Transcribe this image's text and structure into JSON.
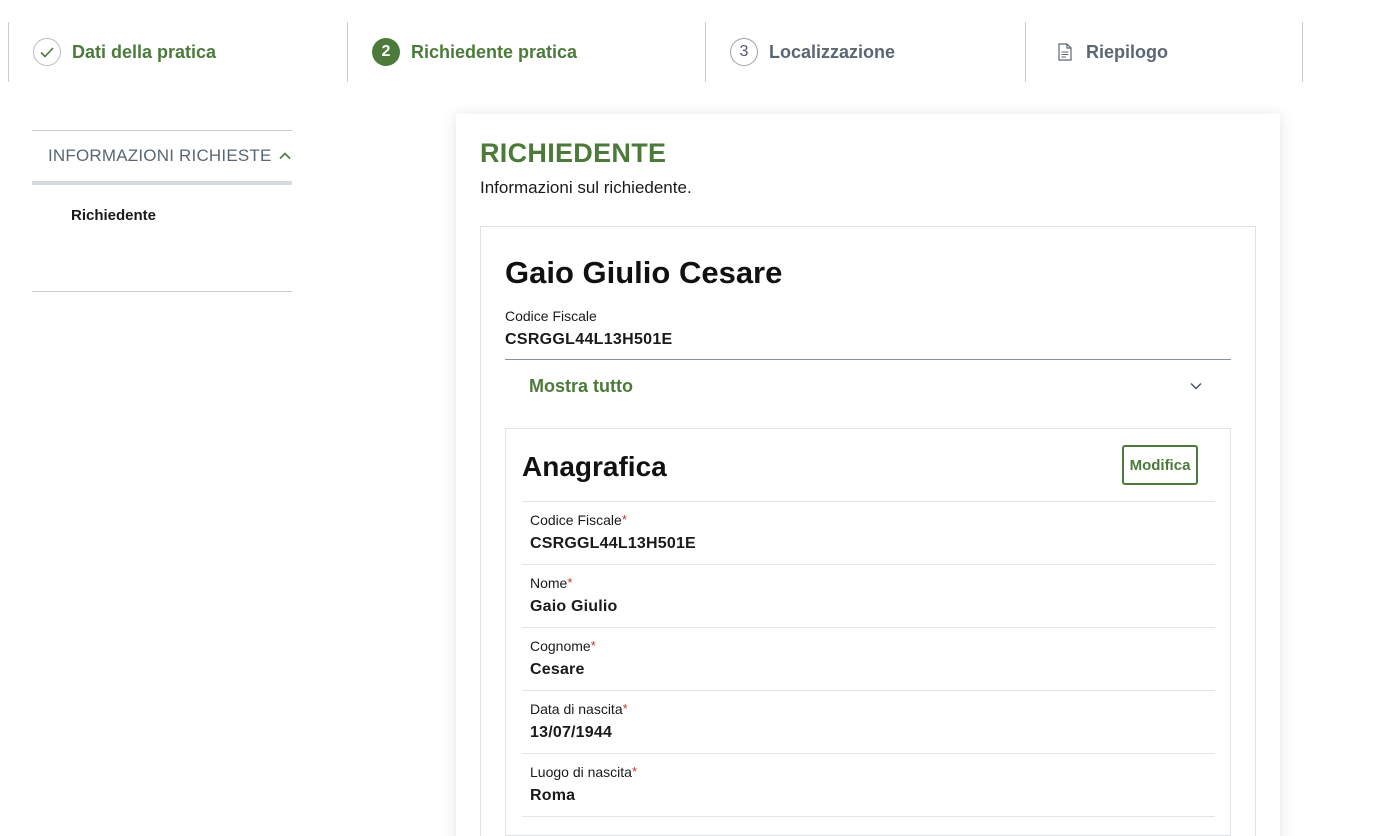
{
  "stepper": {
    "steps": [
      {
        "label": "Dati della pratica",
        "marker": "",
        "state": "completed",
        "icon": "check-icon"
      },
      {
        "label": "Richiedente pratica",
        "marker": "2",
        "state": "active"
      },
      {
        "label": "Localizzazione",
        "marker": "3",
        "state": "pending"
      },
      {
        "label": "Riepilogo",
        "marker": "",
        "state": "pending",
        "icon": "document-icon"
      }
    ]
  },
  "sidenav": {
    "section_title": "INFORMAZIONI RICHIESTE",
    "section_icon": "chevron-up-icon",
    "items": [
      {
        "label": "Richiedente"
      }
    ]
  },
  "main": {
    "title": "RICHIEDENTE",
    "subtitle": "Informazioni sul richiedente.",
    "person": {
      "name": "Gaio Giulio Cesare",
      "cf_label": "Codice Fiscale",
      "cf_value": "CSRGGL44L13H501E",
      "toggle_label": "Mostra tutto",
      "toggle_icon": "chevron-down-icon"
    },
    "anagrafica": {
      "title": "Anagrafica",
      "edit_label": "Modifica",
      "required_marker": "*",
      "fields": [
        {
          "label": "Codice Fiscale",
          "value": "CSRGGL44L13H501E"
        },
        {
          "label": "Nome",
          "value": "Gaio Giulio"
        },
        {
          "label": "Cognome",
          "value": "Cesare"
        },
        {
          "label": "Data di nascita",
          "value": "13/07/1944"
        },
        {
          "label": "Luogo di nascita",
          "value": "Roma"
        }
      ]
    }
  },
  "colors": {
    "accent_green": "#4b7a3a",
    "muted_text": "#5a6772",
    "required_red": "#c0392b"
  }
}
